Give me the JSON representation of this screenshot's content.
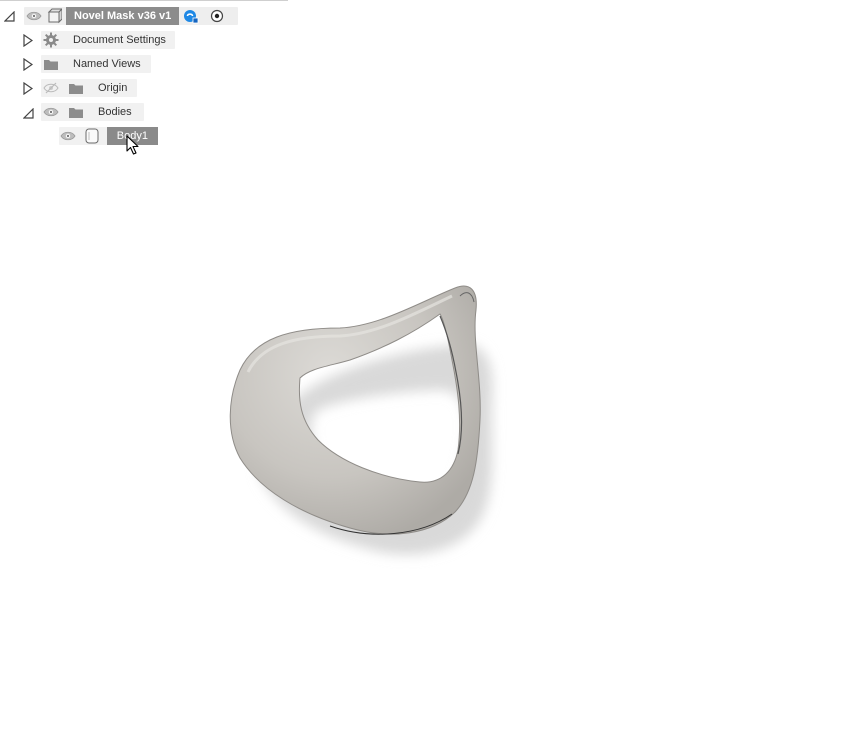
{
  "browser": {
    "root": {
      "label": "Novel Mask v36 v1",
      "eye_icon": "eye-icon",
      "component_icon": "component-icon",
      "link_icon": "link-icon",
      "activate_icon": "radio-activate-icon",
      "expanded": true
    },
    "items": [
      {
        "label": "Document Settings",
        "icon": "gear-icon",
        "expanded": false
      },
      {
        "label": "Named Views",
        "icon": "folder-icon",
        "expanded": false
      },
      {
        "label": "Origin",
        "icon": "folder-icon",
        "visibility": "hidden",
        "expanded": false
      },
      {
        "label": "Bodies",
        "icon": "folder-icon",
        "visibility": "visible",
        "expanded": true
      }
    ],
    "body": {
      "label": "Body1",
      "icon": "body-icon",
      "visibility": "visible",
      "selected": true
    }
  },
  "viewport": {
    "model": "mask-body",
    "colors": {
      "body": "#c9c6c1",
      "shadow": "#e3e3e3",
      "background": "#ffffff"
    }
  }
}
